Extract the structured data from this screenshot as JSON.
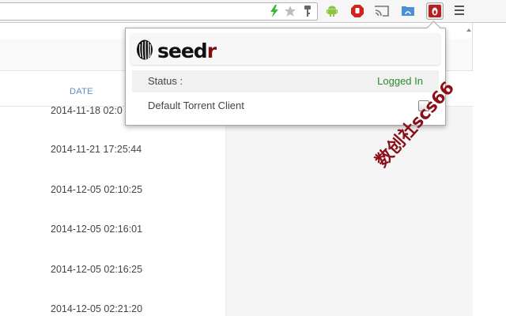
{
  "browser": {
    "menu_icon": "hamburger-menu-icon",
    "extensions": [
      "android-icon",
      "stop-hand-icon",
      "cast-icon",
      "folder-icon",
      "seedr-icon"
    ]
  },
  "table": {
    "date_header": "DATE",
    "rows": [
      "2014-11-18 02:0",
      "2014-11-21 17:25:44",
      "2014-12-05 02:10:25",
      "2014-12-05 02:16:01",
      "2014-12-05 02:16:25",
      "2014-12-05 02:21:20"
    ]
  },
  "popup": {
    "logo_main": "seed",
    "logo_accent": "r",
    "status_label": "Status :",
    "status_value": "Logged In",
    "default_client_label": "Default Torrent Client",
    "default_client_checked": false
  },
  "watermark": "数创社scs66",
  "colors": {
    "accent_blue": "#5a8ec6",
    "status_green": "#2c8a2c",
    "brand_red": "#7d1111",
    "watermark_red": "#8a0f18"
  }
}
